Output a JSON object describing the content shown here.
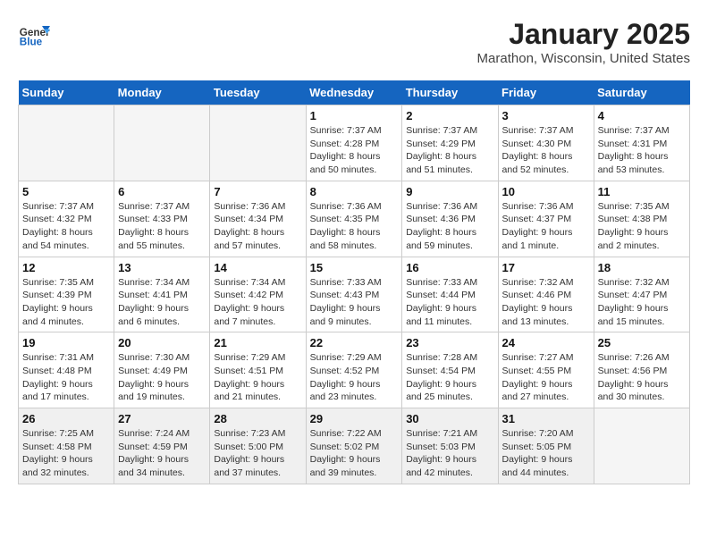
{
  "header": {
    "logo_general": "General",
    "logo_blue": "Blue",
    "month_title": "January 2025",
    "location": "Marathon, Wisconsin, United States"
  },
  "weekdays": [
    "Sunday",
    "Monday",
    "Tuesday",
    "Wednesday",
    "Thursday",
    "Friday",
    "Saturday"
  ],
  "weeks": [
    [
      {
        "day": "",
        "info": ""
      },
      {
        "day": "",
        "info": ""
      },
      {
        "day": "",
        "info": ""
      },
      {
        "day": "1",
        "info": "Sunrise: 7:37 AM\nSunset: 4:28 PM\nDaylight: 8 hours\nand 50 minutes."
      },
      {
        "day": "2",
        "info": "Sunrise: 7:37 AM\nSunset: 4:29 PM\nDaylight: 8 hours\nand 51 minutes."
      },
      {
        "day": "3",
        "info": "Sunrise: 7:37 AM\nSunset: 4:30 PM\nDaylight: 8 hours\nand 52 minutes."
      },
      {
        "day": "4",
        "info": "Sunrise: 7:37 AM\nSunset: 4:31 PM\nDaylight: 8 hours\nand 53 minutes."
      }
    ],
    [
      {
        "day": "5",
        "info": "Sunrise: 7:37 AM\nSunset: 4:32 PM\nDaylight: 8 hours\nand 54 minutes."
      },
      {
        "day": "6",
        "info": "Sunrise: 7:37 AM\nSunset: 4:33 PM\nDaylight: 8 hours\nand 55 minutes."
      },
      {
        "day": "7",
        "info": "Sunrise: 7:36 AM\nSunset: 4:34 PM\nDaylight: 8 hours\nand 57 minutes."
      },
      {
        "day": "8",
        "info": "Sunrise: 7:36 AM\nSunset: 4:35 PM\nDaylight: 8 hours\nand 58 minutes."
      },
      {
        "day": "9",
        "info": "Sunrise: 7:36 AM\nSunset: 4:36 PM\nDaylight: 8 hours\nand 59 minutes."
      },
      {
        "day": "10",
        "info": "Sunrise: 7:36 AM\nSunset: 4:37 PM\nDaylight: 9 hours\nand 1 minute."
      },
      {
        "day": "11",
        "info": "Sunrise: 7:35 AM\nSunset: 4:38 PM\nDaylight: 9 hours\nand 2 minutes."
      }
    ],
    [
      {
        "day": "12",
        "info": "Sunrise: 7:35 AM\nSunset: 4:39 PM\nDaylight: 9 hours\nand 4 minutes."
      },
      {
        "day": "13",
        "info": "Sunrise: 7:34 AM\nSunset: 4:41 PM\nDaylight: 9 hours\nand 6 minutes."
      },
      {
        "day": "14",
        "info": "Sunrise: 7:34 AM\nSunset: 4:42 PM\nDaylight: 9 hours\nand 7 minutes."
      },
      {
        "day": "15",
        "info": "Sunrise: 7:33 AM\nSunset: 4:43 PM\nDaylight: 9 hours\nand 9 minutes."
      },
      {
        "day": "16",
        "info": "Sunrise: 7:33 AM\nSunset: 4:44 PM\nDaylight: 9 hours\nand 11 minutes."
      },
      {
        "day": "17",
        "info": "Sunrise: 7:32 AM\nSunset: 4:46 PM\nDaylight: 9 hours\nand 13 minutes."
      },
      {
        "day": "18",
        "info": "Sunrise: 7:32 AM\nSunset: 4:47 PM\nDaylight: 9 hours\nand 15 minutes."
      }
    ],
    [
      {
        "day": "19",
        "info": "Sunrise: 7:31 AM\nSunset: 4:48 PM\nDaylight: 9 hours\nand 17 minutes."
      },
      {
        "day": "20",
        "info": "Sunrise: 7:30 AM\nSunset: 4:49 PM\nDaylight: 9 hours\nand 19 minutes."
      },
      {
        "day": "21",
        "info": "Sunrise: 7:29 AM\nSunset: 4:51 PM\nDaylight: 9 hours\nand 21 minutes."
      },
      {
        "day": "22",
        "info": "Sunrise: 7:29 AM\nSunset: 4:52 PM\nDaylight: 9 hours\nand 23 minutes."
      },
      {
        "day": "23",
        "info": "Sunrise: 7:28 AM\nSunset: 4:54 PM\nDaylight: 9 hours\nand 25 minutes."
      },
      {
        "day": "24",
        "info": "Sunrise: 7:27 AM\nSunset: 4:55 PM\nDaylight: 9 hours\nand 27 minutes."
      },
      {
        "day": "25",
        "info": "Sunrise: 7:26 AM\nSunset: 4:56 PM\nDaylight: 9 hours\nand 30 minutes."
      }
    ],
    [
      {
        "day": "26",
        "info": "Sunrise: 7:25 AM\nSunset: 4:58 PM\nDaylight: 9 hours\nand 32 minutes."
      },
      {
        "day": "27",
        "info": "Sunrise: 7:24 AM\nSunset: 4:59 PM\nDaylight: 9 hours\nand 34 minutes."
      },
      {
        "day": "28",
        "info": "Sunrise: 7:23 AM\nSunset: 5:00 PM\nDaylight: 9 hours\nand 37 minutes."
      },
      {
        "day": "29",
        "info": "Sunrise: 7:22 AM\nSunset: 5:02 PM\nDaylight: 9 hours\nand 39 minutes."
      },
      {
        "day": "30",
        "info": "Sunrise: 7:21 AM\nSunset: 5:03 PM\nDaylight: 9 hours\nand 42 minutes."
      },
      {
        "day": "31",
        "info": "Sunrise: 7:20 AM\nSunset: 5:05 PM\nDaylight: 9 hours\nand 44 minutes."
      },
      {
        "day": "",
        "info": ""
      }
    ]
  ]
}
